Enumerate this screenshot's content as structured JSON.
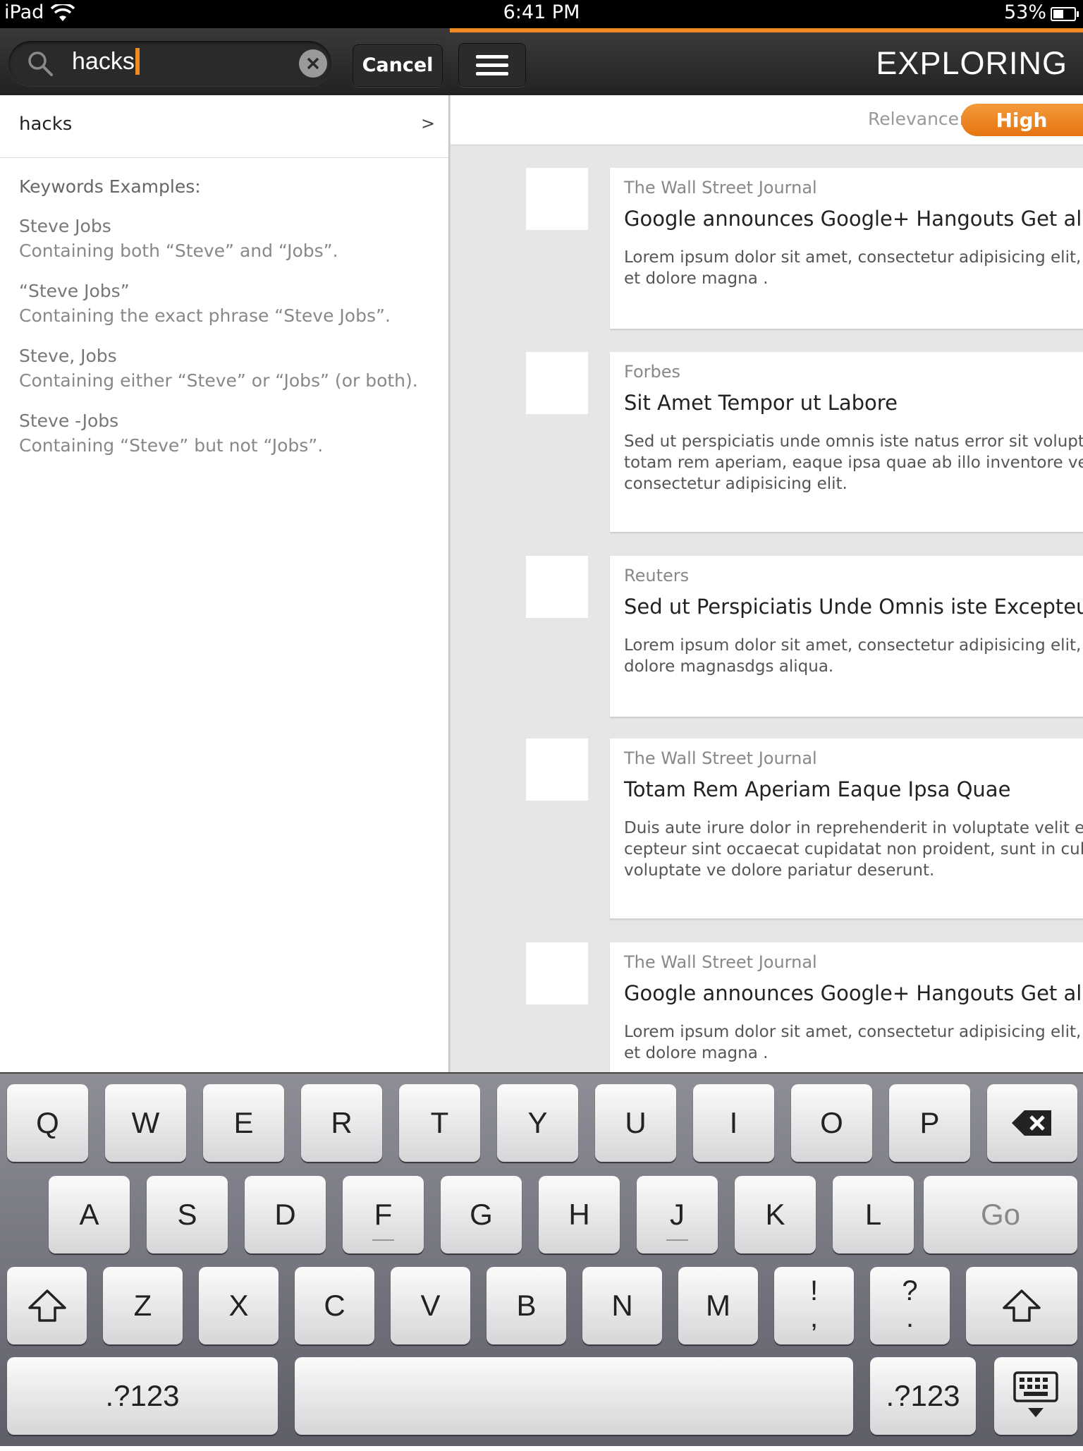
{
  "status_bar": {
    "device": "iPad",
    "time": "6:41 PM",
    "battery": "53%"
  },
  "search": {
    "query": "hacks",
    "cancel_label": "Cancel"
  },
  "header": {
    "title": "EXPLORING"
  },
  "suggestion": {
    "label": "hacks",
    "chevron": ">"
  },
  "examples": {
    "title": "Keywords Examples:",
    "items": [
      {
        "term": "Steve Jobs",
        "desc": "Containing both “Steve” and “Jobs”."
      },
      {
        "term": "“Steve Jobs”",
        "desc": "Containing the exact phrase “Steve Jobs”."
      },
      {
        "term": "Steve, Jobs",
        "desc": "Containing either “Steve” or “Jobs” (or both)."
      },
      {
        "term": "Steve -Jobs",
        "desc": "Containing “Steve” but not “Jobs”."
      }
    ]
  },
  "relevance": {
    "label": "Relevance:",
    "value": "High"
  },
  "articles": [
    {
      "source": "The Wall Street Journal",
      "title": "Google announces Google+ Hangouts Get all new",
      "body": [
        "Lorem ipsum dolor sit amet, consectetur adipisicing elit, sed",
        "et dolore magna ."
      ]
    },
    {
      "source": "Forbes",
      "title": "Sit Amet Tempor ut Labore",
      "body": [
        "Sed ut perspiciatis unde omnis iste natus error sit voluptatem",
        "totam rem aperiam, eaque ipsa quae ab illo inventore veritatis",
        "consectetur adipisicing elit."
      ]
    },
    {
      "source": "Reuters",
      "title": "Sed ut Perspiciatis Unde Omnis iste Excepteur Sint",
      "body": [
        "Lorem ipsum dolor sit amet, consectetur adipisicing elit, sed",
        "dolore magnasdgs aliqua."
      ]
    },
    {
      "source": "The Wall Street Journal",
      "title": "Totam Rem Aperiam Eaque Ipsa Quae",
      "body": [
        "Duis aute irure dolor in reprehenderit in voluptate velit esse",
        "cepteur sint occaecat cupidatat non proident, sunt in culpa",
        "voluptate ve dolore pariatur deserunt."
      ]
    },
    {
      "source": "The Wall Street Journal",
      "title": "Google announces Google+ Hangouts Get all new",
      "body": [
        "Lorem ipsum dolor sit amet, consectetur adipisicing elit, sed",
        "et dolore magna ."
      ]
    }
  ],
  "keyboard": {
    "row1": [
      "Q",
      "W",
      "E",
      "R",
      "T",
      "Y",
      "U",
      "I",
      "O",
      "P"
    ],
    "row2": [
      "A",
      "S",
      "D",
      "F",
      "G",
      "H",
      "J",
      "K",
      "L"
    ],
    "go_label": "Go",
    "row3": [
      "Z",
      "X",
      "C",
      "V",
      "B",
      "N",
      "M"
    ],
    "punct1": [
      "!",
      ","
    ],
    "punct2": [
      "?",
      "."
    ],
    "numbers_label": ".?123"
  },
  "colors": {
    "accent": "#f08a24",
    "header_bg": "#2e2e2e",
    "content_bg": "#e6e6e6"
  },
  "icons": [
    "wifi-icon",
    "battery-icon",
    "search-icon",
    "clear-icon",
    "menu-icon",
    "chevron-right-icon",
    "backspace-icon",
    "shift-icon",
    "hide-keyboard-icon"
  ]
}
